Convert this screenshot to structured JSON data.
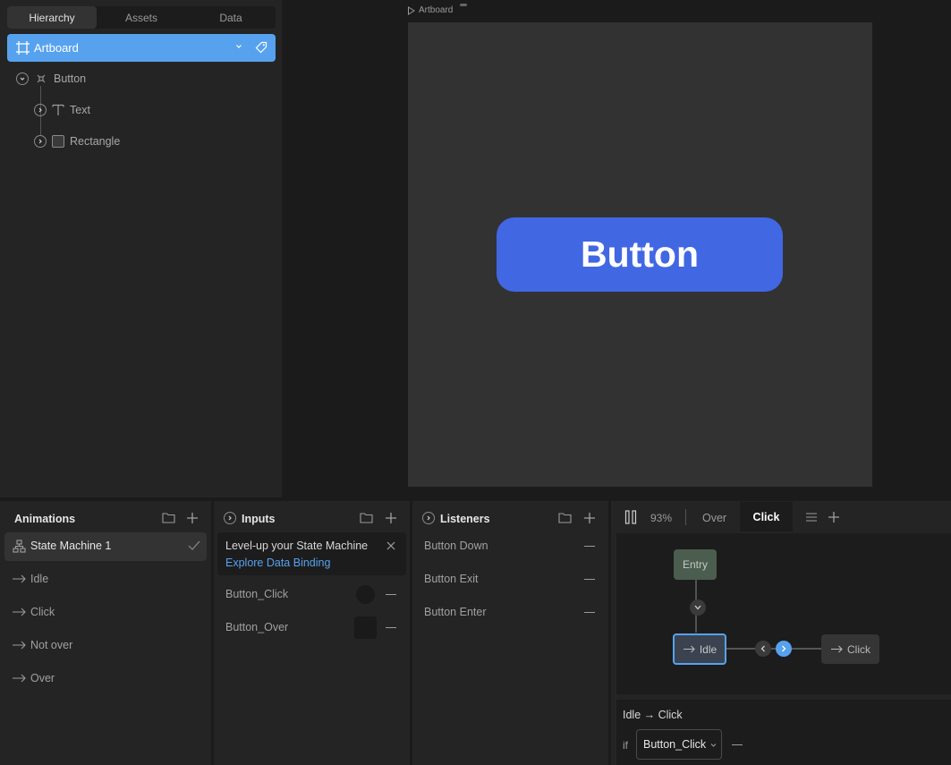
{
  "hierarchy": {
    "tabs": [
      "Hierarchy",
      "Assets",
      "Data"
    ],
    "active_tab": "Hierarchy",
    "artboard_label": "Artboard",
    "tree": [
      {
        "label": "Button",
        "icon": "group-icon"
      },
      {
        "label": "Text",
        "icon": "text-icon"
      },
      {
        "label": "Rectangle",
        "icon": "rectangle-icon"
      }
    ]
  },
  "canvas": {
    "artboard_tag": "Artboard",
    "button_text": "Button",
    "colors": {
      "artboard": "#323232",
      "button": "#4167e3"
    }
  },
  "animations": {
    "title": "Animations",
    "selected": "State Machine 1",
    "items": [
      "Idle",
      "Click",
      "Not over",
      "Over"
    ]
  },
  "inputs": {
    "title": "Inputs",
    "banner_title": "Level-up your State Machine",
    "banner_link": "Explore Data Binding",
    "items": [
      "Button_Click",
      "Button_Over"
    ]
  },
  "listeners": {
    "title": "Listeners",
    "items": [
      "Button Down",
      "Button Exit",
      "Button Enter"
    ]
  },
  "graph": {
    "zoom": "93%",
    "layers": [
      "Over",
      "Click"
    ],
    "active_layer": "Click",
    "nodes": {
      "entry": "Entry",
      "idle": "Idle",
      "click": "Click"
    },
    "transition_title": "Idle → Click",
    "condition_if": "if",
    "condition_input": "Button_Click",
    "accent": "#57a2ee"
  }
}
